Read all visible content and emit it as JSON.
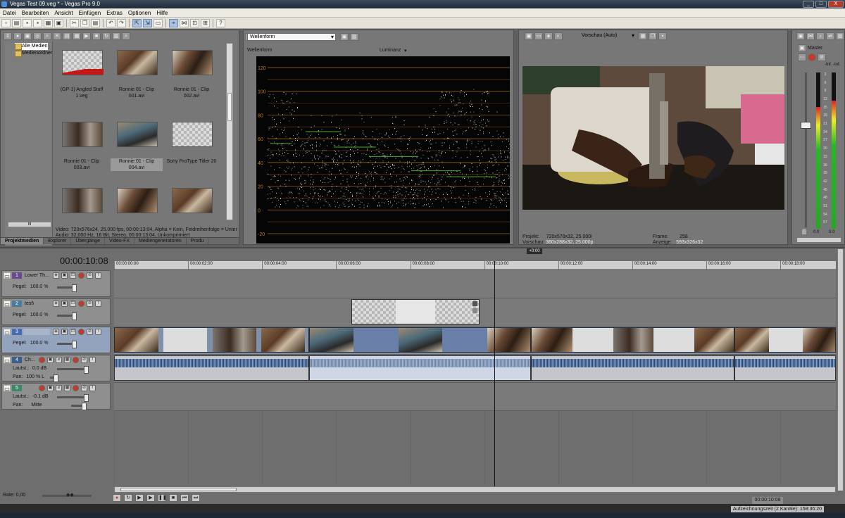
{
  "window": {
    "title": "Vegas Test 09.veg * - Vegas Pro 9.0",
    "controls": [
      "_",
      "□",
      "X"
    ]
  },
  "menu": [
    "Datei",
    "Bearbeiten",
    "Ansicht",
    "Einfügen",
    "Extras",
    "Optionen",
    "Hilfe"
  ],
  "media": {
    "tree": [
      {
        "label": "Alle Medien",
        "selected": true
      },
      {
        "label": "Medienordner",
        "selected": false
      }
    ],
    "tree_scroll": "III",
    "thumbnails": [
      {
        "caption": "(GP-1) Angled Stuff 1.veg",
        "kind": "angled",
        "selected": false
      },
      {
        "caption": "Ronnie 01 - Clip 001.avi",
        "kind": "vid1",
        "selected": false
      },
      {
        "caption": "Ronnie 01 - Clip 002.avi",
        "kind": "vid2",
        "selected": false
      },
      {
        "caption": "Ronnie 01 - Clip 003.avi",
        "kind": "vid3",
        "selected": false
      },
      {
        "caption": "Ronnie 01 - Clip 004.avi",
        "kind": "vid4",
        "selected": true
      },
      {
        "caption": "Sony ProType Titler 20",
        "kind": "checker",
        "selected": false
      },
      {
        "caption": "",
        "kind": "vid3",
        "selected": false
      },
      {
        "caption": "",
        "kind": "vid2",
        "selected": false
      },
      {
        "caption": "",
        "kind": "vid1",
        "selected": false
      }
    ],
    "info_line1": "Video: 720x576x24, 25.000 fps, 00:00:13:04, Alpha = Kein, Feldreihenfolge = Unter",
    "info_line2": "Audio: 32,000 Hz, 16 Bit, Stereo, 00:00:13:04, Unkomprimiert",
    "tabs": [
      {
        "label": "Projektmedien",
        "active": true
      },
      {
        "label": "Explorer",
        "active": false
      },
      {
        "label": "Übergänge",
        "active": false
      },
      {
        "label": "Video-FX",
        "active": false
      },
      {
        "label": "Mediengeneratoren",
        "active": false
      },
      {
        "label": "Produ",
        "active": false
      }
    ]
  },
  "scope": {
    "mode_select": "Wellenform",
    "title": "Wellenform",
    "channel": "Luminanz",
    "y_ticks": [
      120,
      100,
      80,
      60,
      40,
      20,
      0,
      -20
    ]
  },
  "preview": {
    "quality_select": "Vorschau (Auto)",
    "projekt_label": "Projekt:",
    "projekt_value": "720x576x32, 25.000i",
    "vorschau_label": "Vorschau:",
    "vorschau_value": "360x288x32, 25.000p",
    "frame_label": "Frame:",
    "frame_value": "258",
    "anzeige_label": "Anzeige:",
    "anzeige_value": "593x326x32"
  },
  "master": {
    "title": "Master",
    "left_peak": "-Inf.",
    "right_peak": "-Inf.",
    "scale": [
      "3",
      "6",
      "9",
      "12",
      "15",
      "18",
      "21",
      "24",
      "27",
      "30",
      "33",
      "36",
      "39",
      "42",
      "45",
      "48",
      "51",
      "54",
      "57"
    ],
    "readout_l": "0.0",
    "readout_r": "0.0",
    "level_l": 0.78,
    "level_r": 0.82
  },
  "timeline": {
    "timecode": "00:00:10:08",
    "cursor_marker": "+0:00",
    "ruler": [
      "00:00:00:00",
      "00:00:02:00",
      "00:00:04:00",
      "00:00:06:00",
      "00:00:08:00",
      "00:00:10:00",
      "00:00:12:00",
      "00:00:14:00",
      "00:00:16:00",
      "00:00:18:00"
    ],
    "tracks": [
      {
        "num": "1",
        "name": "Lower Th...",
        "type": "video",
        "param_label": "Pegel:",
        "param_value": "100.0 %",
        "num_color": "#6a4a8c"
      },
      {
        "num": "2",
        "name": "test\\",
        "type": "video",
        "param_label": "Pegel:",
        "param_value": "100.0 %",
        "num_color": "#4a7a9c"
      },
      {
        "num": "3",
        "name": "",
        "type": "video",
        "param_label": "Pegel:",
        "param_value": "100.0 %",
        "num_color": "#4a6ab0",
        "selected": true
      },
      {
        "num": "4",
        "name": "Ch...",
        "type": "audio",
        "param_label": "Lautst.:",
        "param_value": "0.0 dB",
        "param2_label": "Pan:",
        "param2_value": "100 % L",
        "num_color": "#3a5f8a"
      },
      {
        "num": "5",
        "name": "",
        "type": "audio",
        "param_label": "Lautst.:",
        "param_value": "-0.1 dB",
        "param2_label": "Pan:",
        "param2_value": "Mitte",
        "num_color": "#3a8a6a"
      }
    ],
    "rate": "Rate: 0,00",
    "end_timecode": "00:00:10:08",
    "status": "Aufzeichnungszeit (2 Kanäle): 158:36:20"
  }
}
